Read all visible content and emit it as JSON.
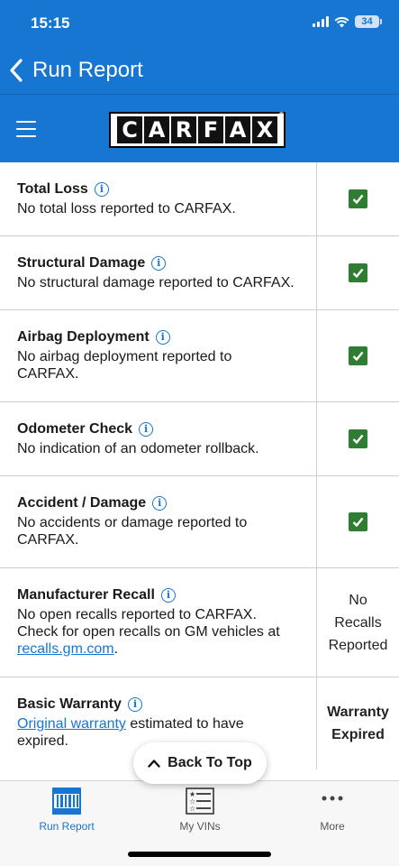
{
  "status_bar": {
    "time": "15:15",
    "battery": "34"
  },
  "nav": {
    "title": "Run Report"
  },
  "logo": {
    "letters": [
      "C",
      "A",
      "R",
      "F",
      "A",
      "X"
    ],
    "registered": "®"
  },
  "rows": [
    {
      "title": "Total Loss",
      "desc": "No total loss reported to CARFAX.",
      "status": "check"
    },
    {
      "title": "Structural Damage",
      "desc": "No structural damage reported to CARFAX.",
      "status": "check"
    },
    {
      "title": "Airbag Deployment",
      "desc": "No airbag deployment reported to CARFAX.",
      "status": "check"
    },
    {
      "title": "Odometer Check",
      "desc": "No indication of an odometer rollback.",
      "status": "check"
    },
    {
      "title": "Accident / Damage",
      "desc": "No accidents or damage reported to CARFAX.",
      "status": "check"
    },
    {
      "title": "Manufacturer Recall",
      "desc": "No open recalls reported to CARFAX. Check for open recalls on GM vehicles at",
      "desc_link": "recalls.gm.com",
      "desc_after": ".",
      "status_text": "No Recalls Reported"
    },
    {
      "title": "Basic Warranty",
      "desc_link_prefix": "Original warranty",
      "desc": "estimated to have expired.",
      "status_text": "Warranty Expired"
    }
  ],
  "back_to_top": "Back To Top",
  "tabs": [
    {
      "label": "Run Report",
      "icon": "barcode-icon",
      "active": true
    },
    {
      "label": "My VINs",
      "icon": "list-icon",
      "active": false
    },
    {
      "label": "More",
      "icon": "more-icon",
      "active": false
    }
  ],
  "colors": {
    "primary": "#1676d2",
    "check": "#2e7d32"
  }
}
